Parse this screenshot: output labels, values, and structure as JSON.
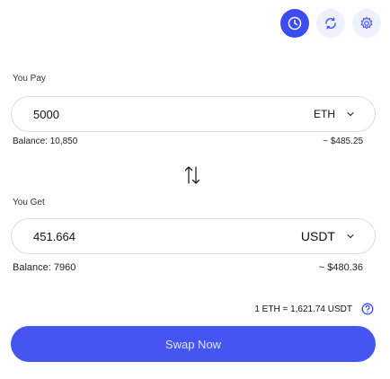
{
  "header": {
    "icons": [
      "history-icon",
      "refresh-icon",
      "settings-icon"
    ],
    "accent_color": "#3b4cf0"
  },
  "pay": {
    "label": "You Pay",
    "amount": "5000",
    "token": "ETH",
    "balance": "Balance: 10,850",
    "usd_value": "~ $485.25"
  },
  "get": {
    "label": "You Get",
    "amount": "451.664",
    "token": "USDT",
    "balance": "Balance: 7960",
    "usd_value": "~ $480.36"
  },
  "rate": {
    "text": "1 ETH = 1,621.74 USDT"
  },
  "swap_button": {
    "label": "Swap Now",
    "color": "#4555f2"
  }
}
